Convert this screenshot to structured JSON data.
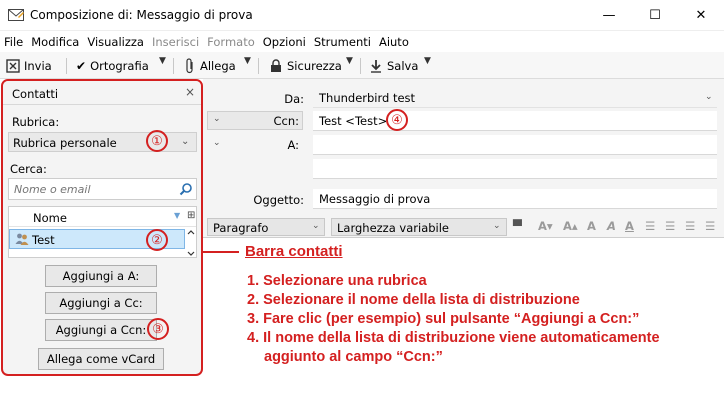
{
  "window": {
    "title": "Composizione di: Messaggio di prova",
    "controls": {
      "minimize": "—",
      "maximize": "☐",
      "close": "✕"
    }
  },
  "menu": [
    {
      "label": "File",
      "disabled": false
    },
    {
      "label": "Modifica",
      "disabled": false
    },
    {
      "label": "Visualizza",
      "disabled": false
    },
    {
      "label": "Inserisci",
      "disabled": true
    },
    {
      "label": "Formato",
      "disabled": true
    },
    {
      "label": "Opzioni",
      "disabled": false
    },
    {
      "label": "Strumenti",
      "disabled": false
    },
    {
      "label": "Aiuto",
      "disabled": false
    }
  ],
  "toolbar": {
    "send": "Invia",
    "spelling": "Ortografia",
    "attach": "Allega",
    "security": "Sicurezza",
    "save": "Salva"
  },
  "sidebar": {
    "title": "Contatti",
    "close": "×",
    "addressbook_label": "Rubrica:",
    "addressbook_value": "Rubrica personale",
    "search_label": "Cerca:",
    "search_placeholder": "Nome o email",
    "column_name": "Nome",
    "contacts": [
      "Test"
    ],
    "buttons": {
      "add_to": "Aggiungi a A:",
      "add_cc": "Aggiungi a Cc:",
      "add_bcc": "Aggiungi a Ccn:",
      "attach_vcard": "Allega come vCard"
    }
  },
  "headers": {
    "from_label": "Da:",
    "from_value": "Thunderbird test",
    "bcc_label": "Ccn:",
    "bcc_value": "Test <Test>",
    "to_label": "A:",
    "to_value": "",
    "subject_label": "Oggetto:",
    "subject_value": "Messaggio di prova"
  },
  "format": {
    "paragraph": "Paragrafo",
    "font": "Larghezza variabile"
  },
  "annotations": {
    "markers": [
      "①",
      "②",
      "③",
      "④"
    ],
    "callout": "Barra contatti",
    "steps": [
      "1. Selezionare una rubrica",
      "2. Selezionare il nome della lista di distribuzione",
      "3. Fare clic (per esempio) sul pulsante “Aggiungi a Ccn:”",
      "4. Il nome della lista di distribuzione viene automaticamente",
      "aggiunto al campo “Ccn:”"
    ],
    "color": "#d42020"
  },
  "colors": {
    "selection": "#cde8fb",
    "panel": "#f4f4f4"
  }
}
